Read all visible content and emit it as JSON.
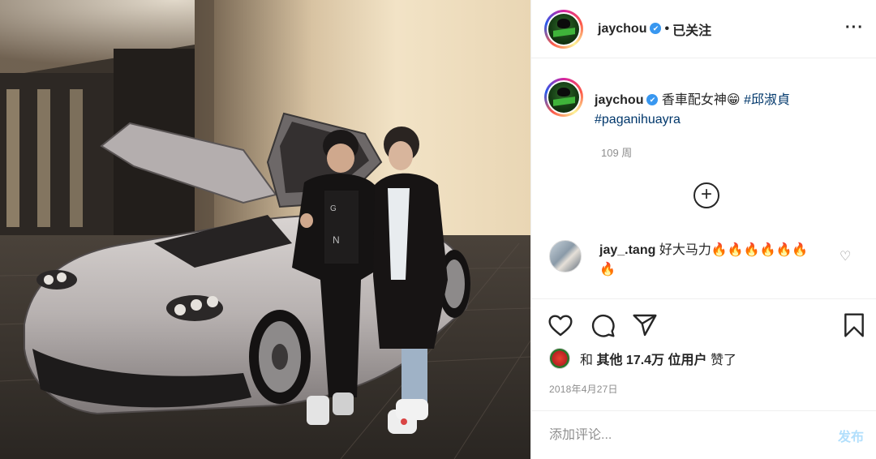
{
  "header": {
    "username": "jaychou",
    "verified_glyph": "✔",
    "separator": "•",
    "follow_state": "已关注",
    "more_glyph": "···"
  },
  "caption": {
    "username": "jaychou",
    "text": "香車配女神😁",
    "hashtag_1": "#邱淑貞",
    "hashtag_2": "#paganihuayra",
    "time_ago": "109 周"
  },
  "load_more_glyph": "+",
  "comments": [
    {
      "username": "jay_.tang",
      "text": "好大马力🔥🔥🔥🔥🔥🔥",
      "text_line2": "🔥"
    }
  ],
  "actions": {
    "like_icon": "heart-icon",
    "comment_icon": "comment-icon",
    "share_icon": "share-icon",
    "save_icon": "bookmark-icon"
  },
  "likes": {
    "prefix": "和",
    "others": "其他 17.4万 位用户",
    "suffix": "赞了"
  },
  "post_date": "2018年4月27日",
  "comment_box": {
    "placeholder": "添加评论...",
    "post_label": "发布"
  },
  "colors": {
    "link": "#00376b",
    "secondary_text": "#8e8e8e",
    "post_disabled": "#b2dffc",
    "border": "#efefef"
  }
}
